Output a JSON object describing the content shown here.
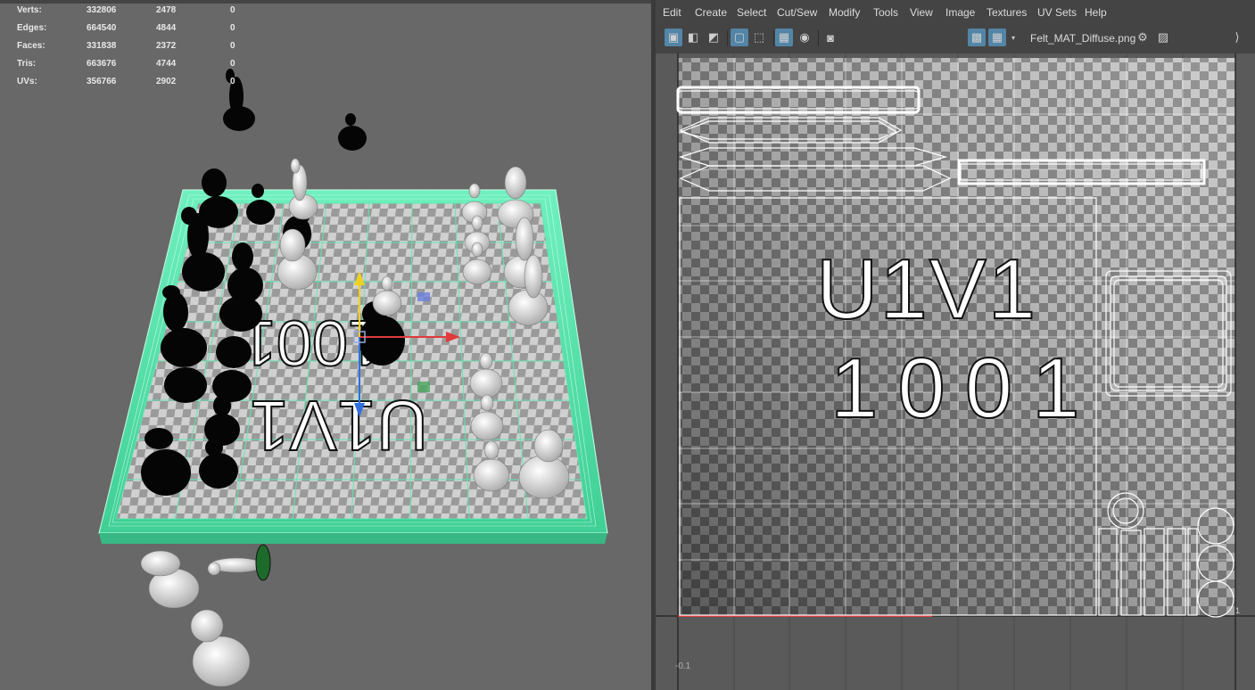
{
  "viewport": {
    "stats": [
      {
        "label": "Verts:",
        "v1": "332806",
        "v2": "2478",
        "v3": "0"
      },
      {
        "label": "Edges:",
        "v1": "664540",
        "v2": "4844",
        "v3": "0"
      },
      {
        "label": "Faces:",
        "v1": "331838",
        "v2": "2372",
        "v3": "0"
      },
      {
        "label": "Tris:",
        "v1": "663676",
        "v2": "4744",
        "v3": "0"
      },
      {
        "label": "UVs:",
        "v1": "356766",
        "v2": "2902",
        "v3": "0"
      }
    ],
    "board_text_1": "1001",
    "board_text_2": "U1V1"
  },
  "uv_editor": {
    "menu": [
      "Edit",
      "Create",
      "Select",
      "Cut/Sew",
      "Modify",
      "Tools",
      "View",
      "Image",
      "Textures",
      "UV Sets",
      "Help"
    ],
    "texture_name": "Felt_MAT_Diffuse.png",
    "canvas_text_1": "U1V1",
    "canvas_text_2": "1001",
    "axis_label_neg": "-0.1",
    "axis_label_one": "1"
  },
  "colors": {
    "selection_highlight": "#4ee8a6",
    "active_button": "#5285a6",
    "manip_x": "#e03a3a",
    "manip_y": "#f0d020",
    "manip_z": "#2f6fe0"
  }
}
